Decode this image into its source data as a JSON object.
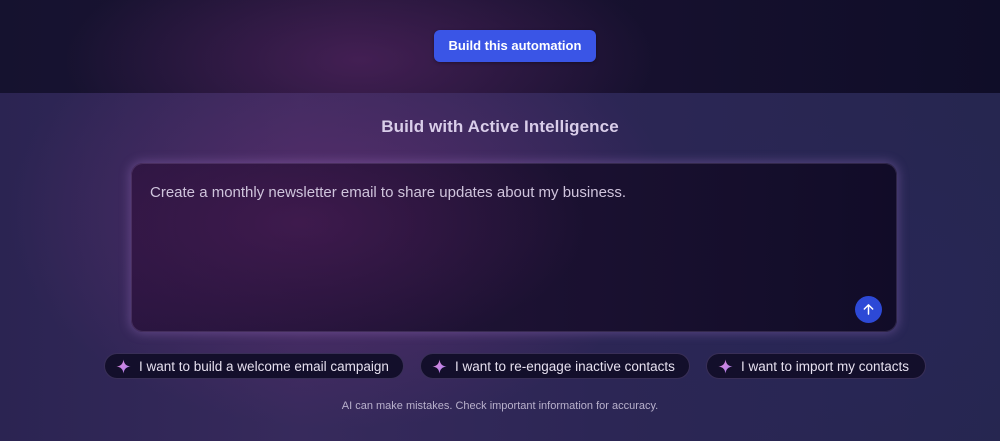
{
  "header": {
    "build_button_label": "Build this automation"
  },
  "panel": {
    "title": "Build with Active Intelligence",
    "prompt_text": "Create a monthly newsletter email to share updates about my business.",
    "send_icon": "arrow-up-icon"
  },
  "suggestions": [
    {
      "label": "I want to build a welcome email campaign",
      "icon": "sparkle-icon"
    },
    {
      "label": "I want to re-engage inactive contacts",
      "icon": "sparkle-icon"
    },
    {
      "label": "I want to import my contacts",
      "icon": "sparkle-icon"
    }
  ],
  "disclaimer": "AI can make mistakes. Check important information for accuracy.",
  "colors": {
    "primary_button": "#3a55e6",
    "send_button": "#2d49d6",
    "sparkle_pink": "#e58bd8",
    "sparkle_violet": "#a77ff0"
  }
}
